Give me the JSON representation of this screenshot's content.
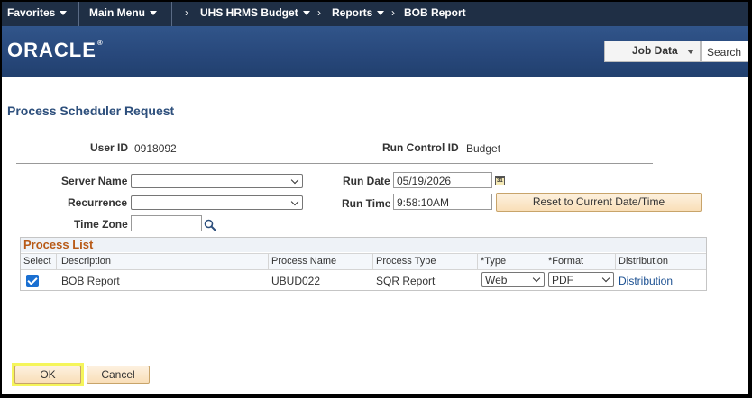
{
  "nav": {
    "favorites": "Favorites",
    "main_menu": "Main Menu",
    "breadcrumbs": [
      "UHS HRMS Budget",
      "Reports",
      "BOB Report"
    ]
  },
  "brand": {
    "logo": "ORACLE",
    "logo_mark": "®",
    "search_scope": "Job Data",
    "search_button": "Search"
  },
  "page": {
    "title": "Process Scheduler Request",
    "user_id_label": "User ID",
    "user_id": "0918092",
    "run_control_label": "Run Control ID",
    "run_control_id": "Budget",
    "server_name_label": "Server Name",
    "server_name": "",
    "recurrence_label": "Recurrence",
    "recurrence": "",
    "time_zone_label": "Time Zone",
    "time_zone": "",
    "run_date_label": "Run Date",
    "run_date": "05/19/2026",
    "calendar_glyph": "31",
    "run_time_label": "Run Time",
    "run_time": "9:58:10AM",
    "reset_button": "Reset to Current Date/Time"
  },
  "process_list": {
    "title": "Process List",
    "columns": [
      "Select",
      "Description",
      "Process Name",
      "Process Type",
      "*Type",
      "*Format",
      "Distribution"
    ],
    "rows": [
      {
        "selected": true,
        "description": "BOB Report",
        "process_name": "UBUD022",
        "process_type": "SQR Report",
        "type": "Web",
        "format": "PDF",
        "distribution": "Distribution"
      }
    ]
  },
  "buttons": {
    "ok": "OK",
    "cancel": "Cancel"
  },
  "colors": {
    "nav_bg": "#1f2f45",
    "brand_bg": "#27477a",
    "title_color": "#2d4f7c",
    "process_list_title": "#b85a17",
    "ok_highlight": "#f5f55a",
    "button_bg": "#f9dfb8",
    "link": "#1a4f91"
  }
}
